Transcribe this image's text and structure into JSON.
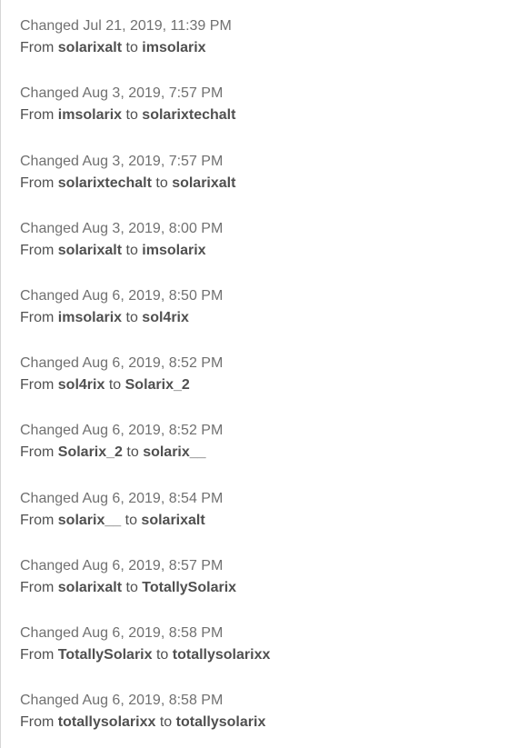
{
  "history": {
    "changed_prefix": "Changed",
    "from_word": "From",
    "to_word": "to",
    "entries": [
      {
        "timestamp": "Jul 21, 2019, 11:39 PM",
        "from": "solarixalt",
        "to": "imsolarix"
      },
      {
        "timestamp": "Aug 3, 2019, 7:57 PM",
        "from": "imsolarix",
        "to": "solarixtechalt"
      },
      {
        "timestamp": "Aug 3, 2019, 7:57 PM",
        "from": "solarixtechalt",
        "to": "solarixalt"
      },
      {
        "timestamp": "Aug 3, 2019, 8:00 PM",
        "from": "solarixalt",
        "to": "imsolarix"
      },
      {
        "timestamp": "Aug 6, 2019, 8:50 PM",
        "from": "imsolarix",
        "to": "sol4rix"
      },
      {
        "timestamp": "Aug 6, 2019, 8:52 PM",
        "from": "sol4rix",
        "to": "Solarix_2"
      },
      {
        "timestamp": "Aug 6, 2019, 8:52 PM",
        "from": "Solarix_2",
        "to": "solarix__"
      },
      {
        "timestamp": "Aug 6, 2019, 8:54 PM",
        "from": "solarix__",
        "to": "solarixalt"
      },
      {
        "timestamp": "Aug 6, 2019, 8:57 PM",
        "from": "solarixalt",
        "to": "TotallySolarix"
      },
      {
        "timestamp": "Aug 6, 2019, 8:58 PM",
        "from": "TotallySolarix",
        "to": "totallysolarixx"
      },
      {
        "timestamp": "Aug 6, 2019, 8:58 PM",
        "from": "totallysolarixx",
        "to": "totallysolarix"
      }
    ]
  }
}
